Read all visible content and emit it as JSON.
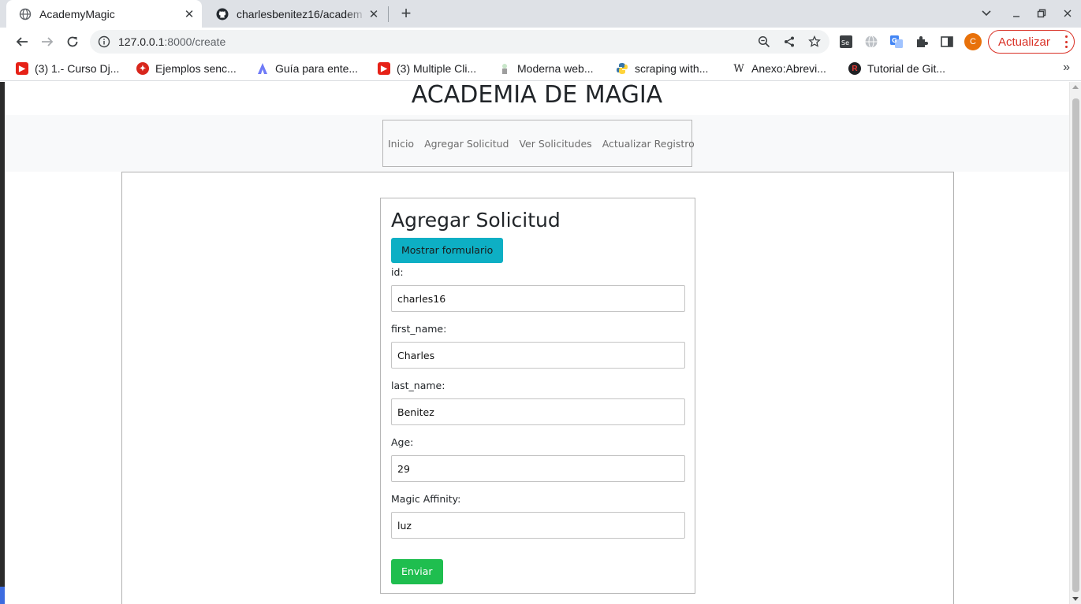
{
  "browser": {
    "tabs": [
      {
        "title": "AcademyMagic",
        "active": true
      },
      {
        "title": "charlesbenitez16/academ",
        "active": false
      }
    ],
    "url": {
      "host": "127.0.0.1",
      "path": ":8000/create"
    },
    "profile_initial": "C",
    "update_label": "Actualizar",
    "bookmarks": [
      {
        "label": "(3) 1.- Curso Dj...",
        "icon": "youtube-icon"
      },
      {
        "label": "Ejemplos senc...",
        "icon": "python-red-icon"
      },
      {
        "label": "Guía para ente...",
        "icon": "brand-icon"
      },
      {
        "label": "(3) Multiple Cli...",
        "icon": "youtube-icon"
      },
      {
        "label": "Moderna web...",
        "icon": "page-icon"
      },
      {
        "label": "scraping with...",
        "icon": "python-icon"
      },
      {
        "label": "Anexo:Abrevi...",
        "icon": "wikipedia-icon"
      },
      {
        "label": "Tutorial de Git...",
        "icon": "r-icon"
      }
    ]
  },
  "site": {
    "title": "ACADEMIA DE MAGIA",
    "nav": [
      "Inicio",
      "Agregar Solicitud",
      "Ver Solicitudes",
      "Actualizar Registro"
    ]
  },
  "form": {
    "heading": "Agregar Solicitud",
    "toggle_label": "Mostrar formulario",
    "fields": [
      {
        "label": "id:",
        "value": "charles16"
      },
      {
        "label": "first_name:",
        "value": "Charles"
      },
      {
        "label": "last_name:",
        "value": "Benitez"
      },
      {
        "label": "Age:",
        "value": "29"
      },
      {
        "label": "Magic Affinity:",
        "value": "luz"
      }
    ],
    "submit_label": "Enviar"
  },
  "colors": {
    "toggle_button": "#0dafc4",
    "submit_button": "#1fbe4f",
    "update_accent": "#d93025"
  }
}
